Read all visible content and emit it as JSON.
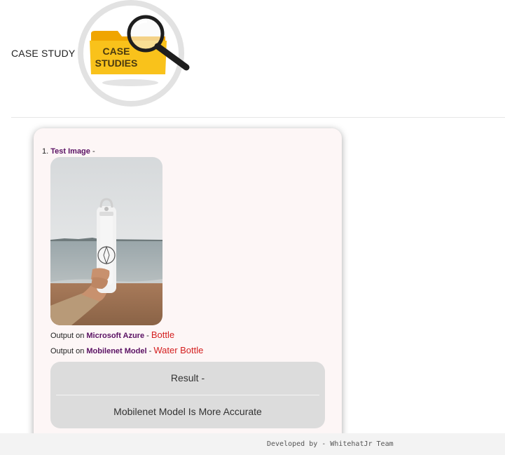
{
  "header": {
    "title": "CASE STUDY",
    "logo_text_line1": "CASE",
    "logo_text_line2": "STUDIES",
    "logo_icon": "magnifier-folder-icon"
  },
  "case": {
    "number": "1.",
    "test_label": "Test Image",
    "test_suffix": " -",
    "image_icon": "water-bottle-photo",
    "outputs": [
      {
        "prefix": "Output on ",
        "model": "Microsoft Azure",
        "sep": " - ",
        "value": "Bottle"
      },
      {
        "prefix": "Output on ",
        "model": "Mobilenet Model",
        "sep": " - ",
        "value": "Water Bottle"
      }
    ],
    "result": {
      "title": "Result -",
      "text": "Mobilenet Model Is More Accurate"
    }
  },
  "footer": {
    "text": "Developed by - WhitehatJr Team"
  },
  "colors": {
    "accent_purple": "#5a1163",
    "value_red": "#d42020",
    "card_bg": "#fdf6f6",
    "result_bg": "#dcdcdc",
    "folder_yellow": "#f9c21b"
  }
}
